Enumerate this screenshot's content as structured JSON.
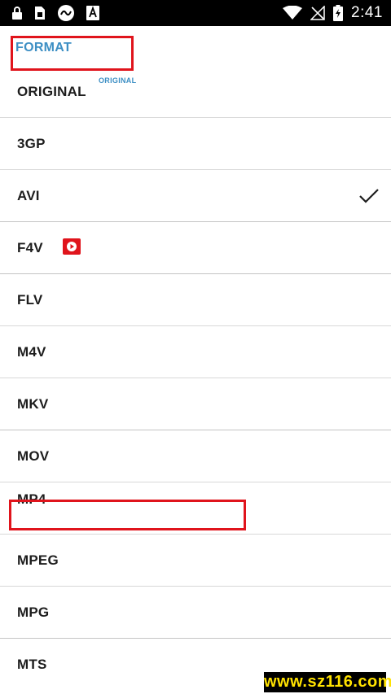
{
  "status_bar": {
    "time": "2:41",
    "icons": [
      "lock-icon",
      "sim-card-icon",
      "app-logo-icon",
      "font-a-icon",
      "wifi-icon",
      "no-signal-icon",
      "battery-charging-icon"
    ]
  },
  "header": {
    "title": "FORMAT",
    "selected_value": "ORIGINAL"
  },
  "formats": [
    {
      "label": "ORIGINAL"
    },
    {
      "label": "3GP"
    },
    {
      "label": "AVI",
      "selected": true
    },
    {
      "label": "F4V",
      "badge": "play-icon"
    },
    {
      "label": "FLV"
    },
    {
      "label": "M4V"
    },
    {
      "label": "MKV"
    },
    {
      "label": "MOV"
    },
    {
      "label": "MP4",
      "highlighted": true
    },
    {
      "label": "MPEG"
    },
    {
      "label": "MPG"
    },
    {
      "label": "MTS"
    }
  ],
  "watermark": "www.sz116.com",
  "colors": {
    "accent": "#3d8fc4",
    "highlight": "#e0141c",
    "text": "#1d1d1d"
  }
}
